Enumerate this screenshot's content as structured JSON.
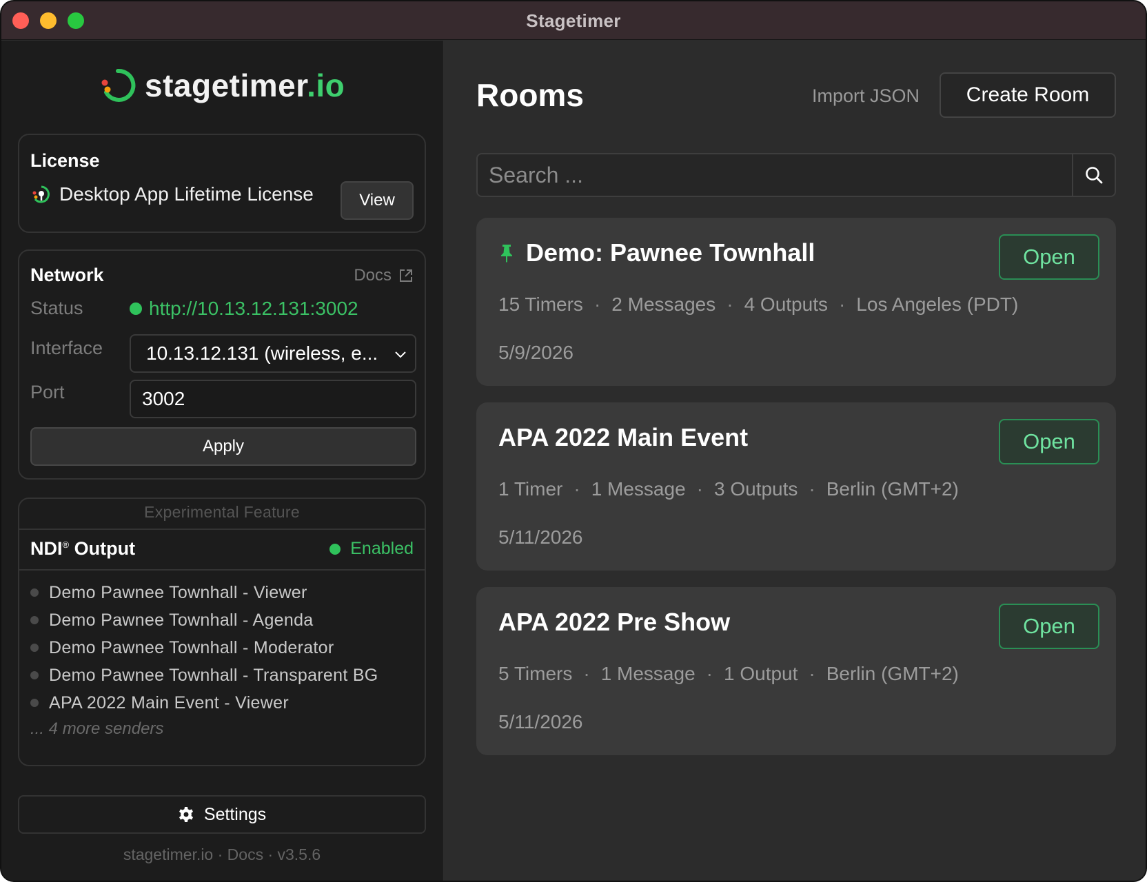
{
  "window": {
    "title": "Stagetimer"
  },
  "sidebar": {
    "logo": {
      "name": "stagetimer",
      "tld": ".io"
    },
    "license": {
      "title": "License",
      "name": "Desktop App Lifetime License",
      "view_label": "View"
    },
    "network": {
      "title": "Network",
      "docs_label": "Docs",
      "status_label": "Status",
      "status_value": "http://10.13.12.131:3002",
      "interface_label": "Interface",
      "interface_value": "10.13.12.131 (wireless, e...",
      "port_label": "Port",
      "port_value": "3002",
      "apply_label": "Apply"
    },
    "ndi": {
      "experimental_label": "Experimental Feature",
      "title": "NDI",
      "title_mark": "®",
      "title_suffix": " Output",
      "status": "Enabled",
      "senders": [
        "Demo Pawnee Townhall - Viewer",
        "Demo Pawnee Townhall - Agenda",
        "Demo Pawnee Townhall - Moderator",
        "Demo Pawnee Townhall - Transparent BG",
        "APA 2022 Main Event - Viewer"
      ],
      "more_label": "... 4 more senders"
    },
    "settings_label": "Settings",
    "footer": "stagetimer.io · Docs · v3.5.6"
  },
  "main": {
    "title": "Rooms",
    "import_label": "Import JSON",
    "create_label": "Create Room",
    "search_placeholder": "Search ...",
    "rooms": [
      {
        "name": "Demo: Pawnee Townhall",
        "pinned": true,
        "timers": "15 Timers",
        "messages": "2 Messages",
        "outputs": "4 Outputs",
        "timezone": "Los Angeles (PDT)",
        "date": "5/9/2026",
        "open_label": "Open"
      },
      {
        "name": "APA 2022 Main Event",
        "pinned": false,
        "timers": "1 Timer",
        "messages": "1 Message",
        "outputs": "3 Outputs",
        "timezone": "Berlin (GMT+2)",
        "date": "5/11/2026",
        "open_label": "Open"
      },
      {
        "name": "APA 2022 Pre Show",
        "pinned": false,
        "timers": "5 Timers",
        "messages": "1 Message",
        "outputs": "1 Output",
        "timezone": "Berlin (GMT+2)",
        "date": "5/11/2026",
        "open_label": "Open"
      }
    ],
    "meta_separator": "·"
  },
  "colors": {
    "accent_green": "#3bc165",
    "open_button_text": "#6fe3a0",
    "logo_red": "#e8453c",
    "logo_orange": "#f59e0b"
  },
  "icons": [
    "logo-mark",
    "license-badge-icon",
    "external-link-icon",
    "chevron-down-icon",
    "search-icon",
    "pin-icon",
    "gear-icon"
  ]
}
